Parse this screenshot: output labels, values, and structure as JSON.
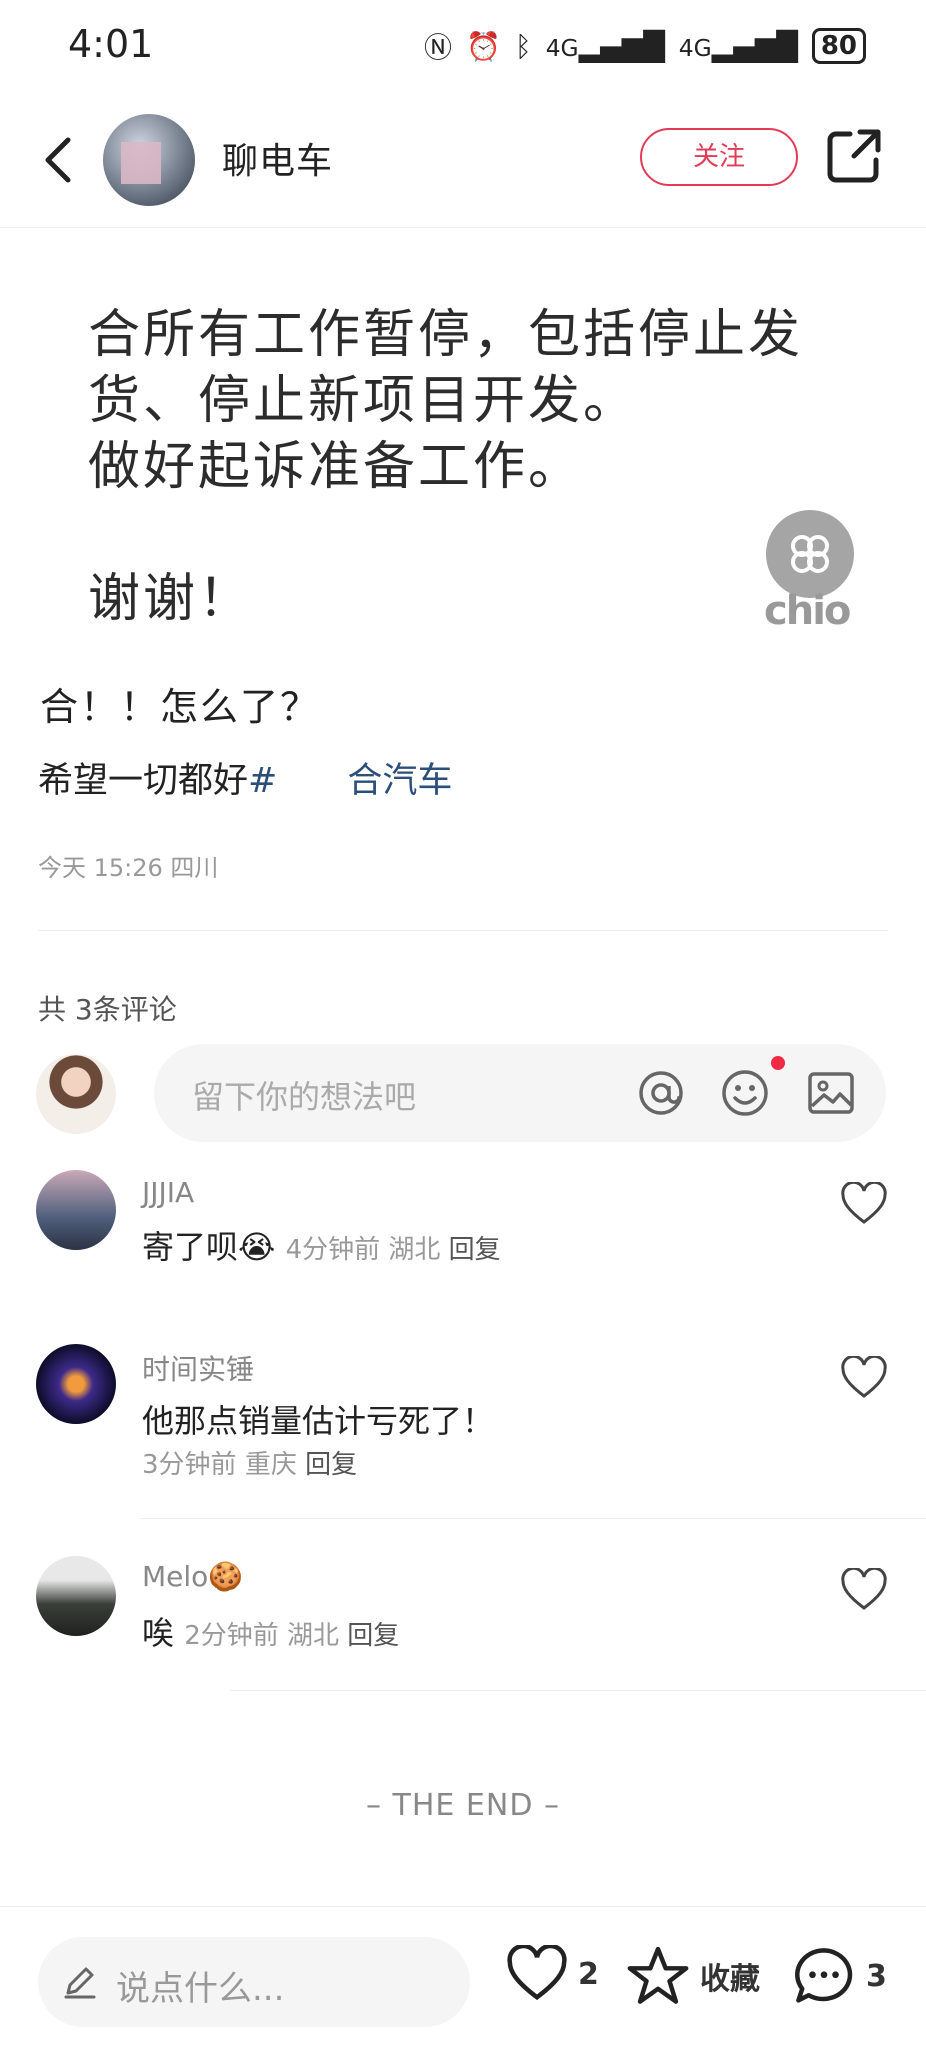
{
  "status_bar": {
    "time": "4:01",
    "network1": "4G",
    "network2": "4G",
    "battery": "80"
  },
  "header": {
    "author": "聊电车",
    "follow_label": "关注"
  },
  "post_image": {
    "lines": [
      "合所有工作暂停，包括停止发",
      "货、停止新项目开发。",
      "做好起诉准备工作。",
      "",
      "谢谢！"
    ],
    "watermark_text": "chio"
  },
  "post": {
    "title": "合！！怎么了？",
    "body_text": "希望一切都好",
    "hashtag": "#　　合汽车",
    "meta": "今天 15:26 四川"
  },
  "comments_section": {
    "count_label": "共 3条评论",
    "input_placeholder": "留下你的想法吧"
  },
  "comments": [
    {
      "name": "JJJIA",
      "text": "寄了呗",
      "emoji": "😭",
      "time": "4分钟前",
      "location": "湖北",
      "reply": "回复"
    },
    {
      "name": "时间实锤",
      "text": "他那点销量估计亏死了！",
      "time": "3分钟前",
      "location": "重庆",
      "reply": "回复"
    },
    {
      "name": "Melo",
      "name_emoji": "🍪",
      "text": "唉",
      "time": "2分钟前",
      "location": "湖北",
      "reply": "回复"
    }
  ],
  "end_label": "– THE END –",
  "bottom_bar": {
    "say_placeholder": "说点什么...",
    "like_count": "2",
    "collect_label": "收藏",
    "comment_count": "3"
  },
  "colors": {
    "accent": "#e33b57",
    "hashtag": "#2b4f7a",
    "red_dot": "#ee2a44"
  }
}
